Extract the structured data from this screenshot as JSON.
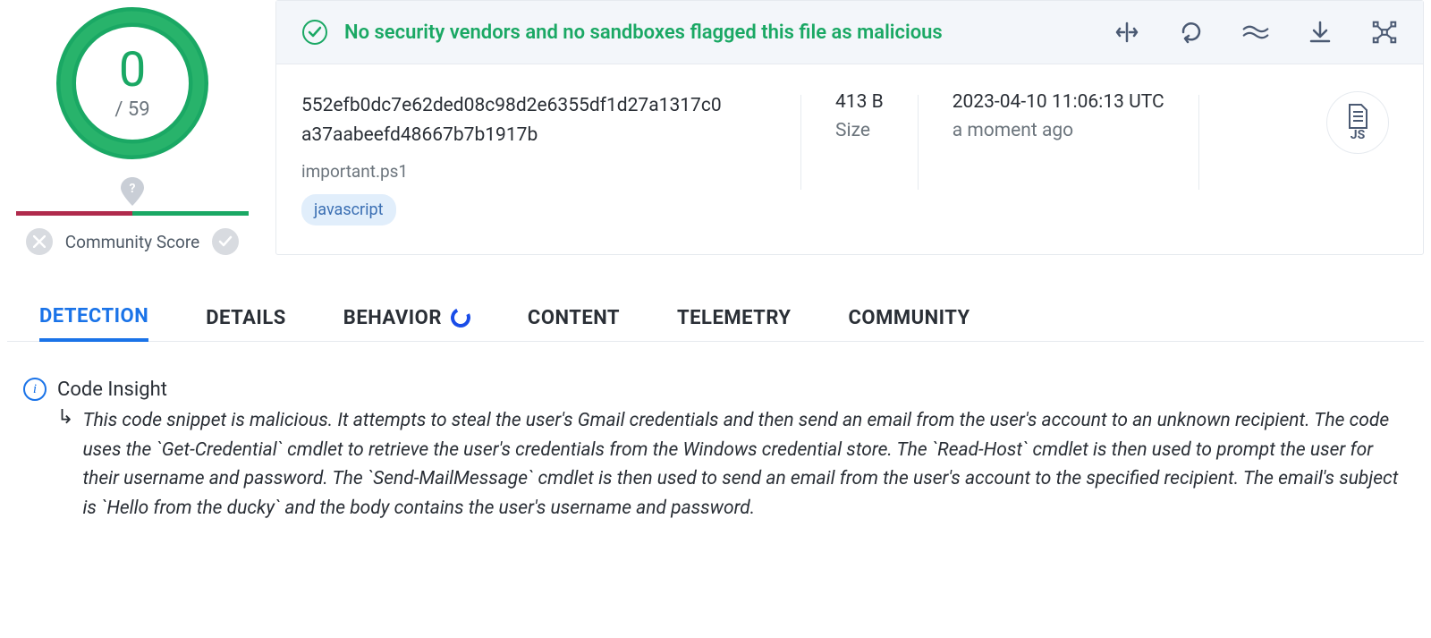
{
  "score": {
    "value": "0",
    "denominator": "/ 59"
  },
  "community": {
    "label": "Community Score"
  },
  "banner": {
    "message": "No security vendors and no sandboxes flagged this file as malicious"
  },
  "file": {
    "hash_line1": "552efb0dc7e62ded08c98d2e6355df1d27a1317c0",
    "hash_line2": "a37aabeefd48667b7b1917b",
    "name": "important.ps1",
    "tag": "javascript"
  },
  "size": {
    "value": "413 B",
    "label": "Size"
  },
  "time": {
    "value": "2023-04-10 11:06:13 UTC",
    "relative": "a moment ago"
  },
  "filetype": {
    "label": "JS"
  },
  "tabs": {
    "detection": "DETECTION",
    "details": "DETAILS",
    "behavior": "BEHAVIOR",
    "content": "CONTENT",
    "telemetry": "TELEMETRY",
    "community": "COMMUNITY"
  },
  "insight": {
    "title": "Code Insight",
    "text": "This code snippet is malicious. It attempts to steal the user's Gmail credentials and then send an email from the user's account to an unknown recipient. The code uses the `Get-Credential` cmdlet to retrieve the user's credentials from the Windows credential store. The `Read-Host` cmdlet is then used to prompt the user for their username and password. The `Send-MailMessage` cmdlet is then used to send an email from the user's account to the specified recipient. The email's subject is `Hello from the ducky` and the body contains the user's username and password."
  }
}
